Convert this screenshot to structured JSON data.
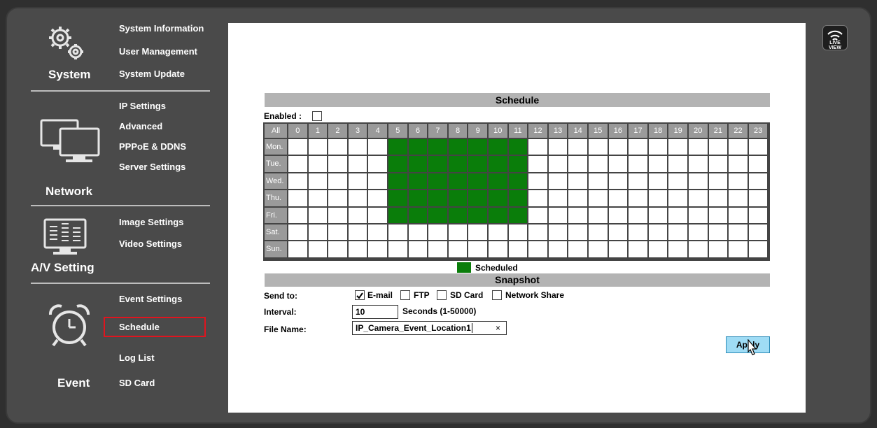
{
  "sidebar": {
    "system": {
      "title": "System",
      "items": [
        "System Information",
        "User Management",
        "System Update"
      ]
    },
    "network": {
      "title": "Network",
      "items": [
        "IP Settings",
        "Advanced",
        "PPPoE & DDNS",
        "Server Settings"
      ]
    },
    "av": {
      "title": "A/V Setting",
      "items": [
        "Image Settings",
        "Video Settings"
      ]
    },
    "event": {
      "title": "Event",
      "items": [
        "Event Settings",
        "Schedule",
        "Log List",
        "SD Card"
      ],
      "selected": "Schedule"
    }
  },
  "live_view": {
    "label": "LIVE VIEW"
  },
  "schedule": {
    "title": "Schedule",
    "enabled_label": "Enabled :",
    "enabled": false,
    "all_label": "All",
    "hours": [
      "0",
      "1",
      "2",
      "3",
      "4",
      "5",
      "6",
      "7",
      "8",
      "9",
      "10",
      "11",
      "12",
      "13",
      "14",
      "15",
      "16",
      "17",
      "18",
      "19",
      "20",
      "21",
      "22",
      "23"
    ],
    "days": [
      "Mon.",
      "Tue.",
      "Wed.",
      "Thu.",
      "Fri.",
      "Sat.",
      "Sun."
    ],
    "scheduled_hours": {
      "Mon.": [
        5,
        6,
        7,
        8,
        9,
        10,
        11
      ],
      "Tue.": [
        5,
        6,
        7,
        8,
        9,
        10,
        11
      ],
      "Wed.": [
        5,
        6,
        7,
        8,
        9,
        10,
        11
      ],
      "Thu.": [
        5,
        6,
        7,
        8,
        9,
        10,
        11
      ],
      "Fri.": [
        5,
        6,
        7,
        8,
        9,
        10,
        11
      ],
      "Sat.": [],
      "Sun.": []
    },
    "legend": "Scheduled"
  },
  "snapshot": {
    "title": "Snapshot",
    "send_to_label": "Send to:",
    "options": [
      {
        "label": "E-mail",
        "checked": true
      },
      {
        "label": "FTP",
        "checked": false
      },
      {
        "label": "SD Card",
        "checked": false
      },
      {
        "label": "Network Share",
        "checked": false
      }
    ],
    "interval_label": "Interval:",
    "interval_value": "10",
    "interval_unit": "Seconds (1-50000)",
    "file_name_label": "File Name:",
    "file_name_value": "IP_Camera_Event_Location1",
    "clear_glyph": "×",
    "apply_label": "Apply"
  },
  "colors": {
    "scheduled": "#0a7d0a",
    "header": "#b3b3b3",
    "selected_outline": "#e0141e"
  }
}
